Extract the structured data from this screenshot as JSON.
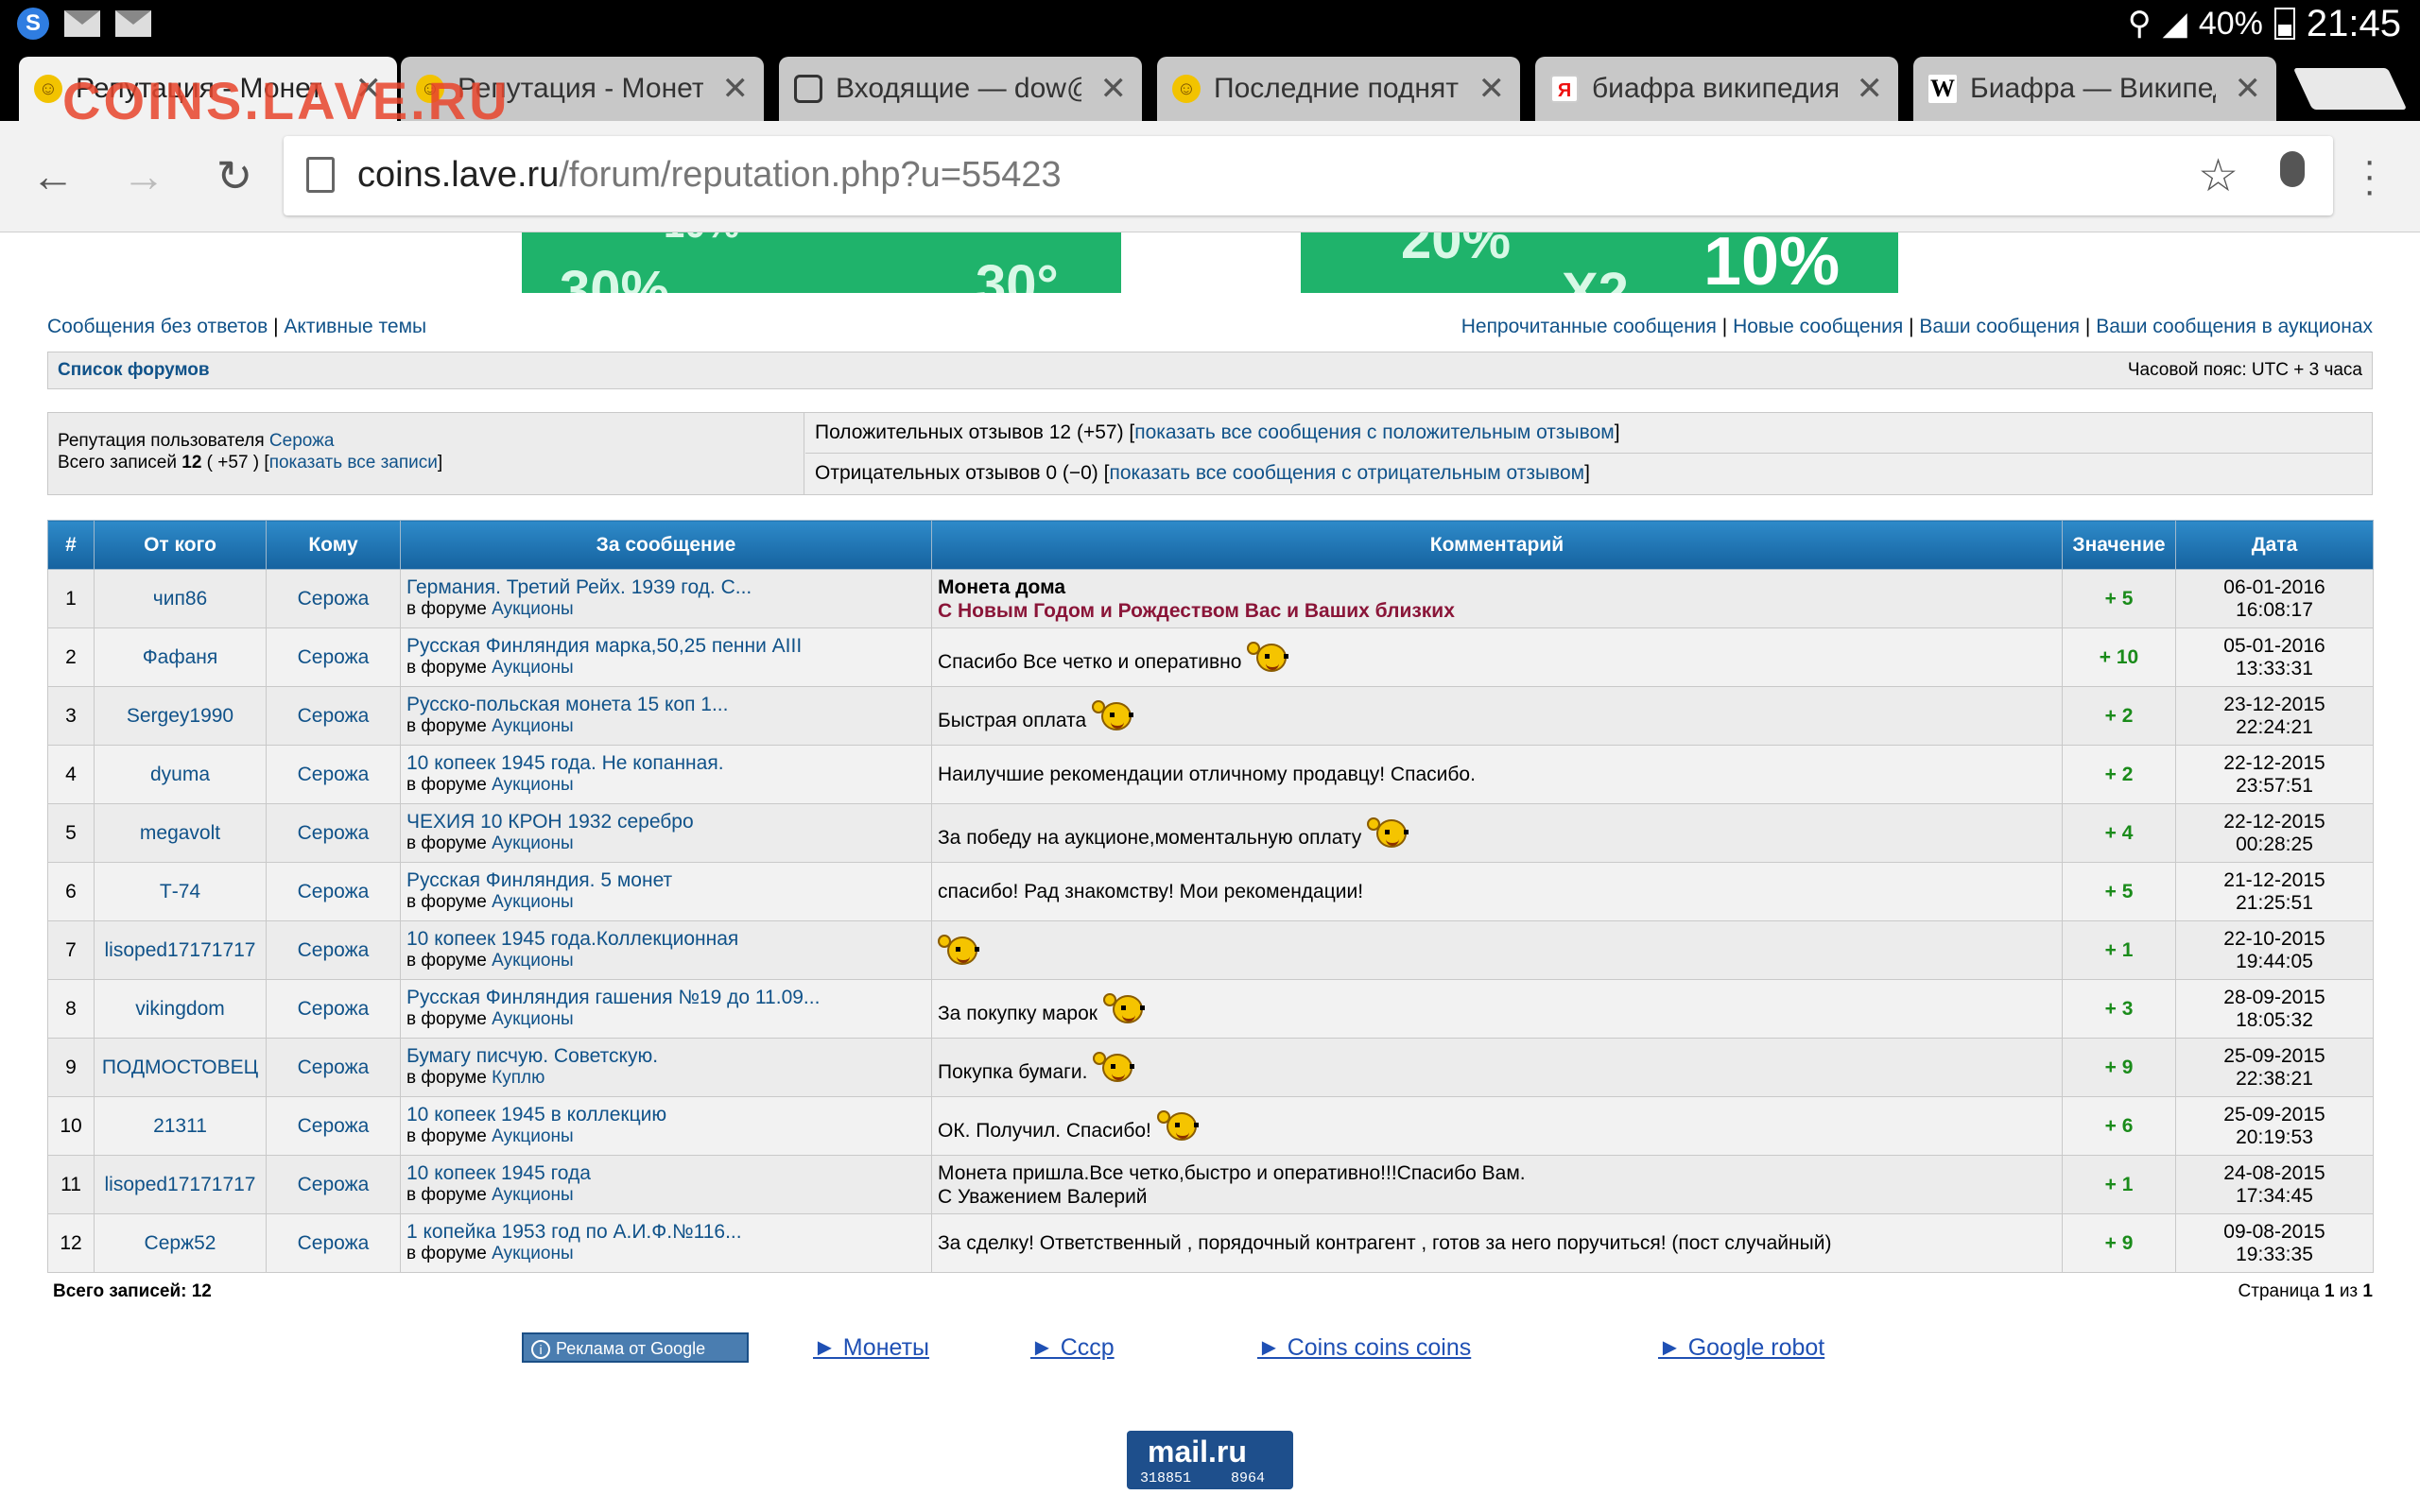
{
  "status_bar": {
    "battery": "40%",
    "time": "21:45"
  },
  "watermark": "COINS.LAVE.RU",
  "tabs": [
    {
      "title": "Репутация - Монеты",
      "icon": "smiley-favicon-icon",
      "active": true
    },
    {
      "title": "Репутация - Монеты",
      "icon": "smiley-favicon-icon",
      "active": false
    },
    {
      "title": "Входящие — dow@ra",
      "icon": "mail-icon",
      "active": false
    },
    {
      "title": "Последние подняты",
      "icon": "smiley-favicon-icon",
      "active": false
    },
    {
      "title": "биафра википедия -",
      "icon": "yandex-icon",
      "active": false
    },
    {
      "title": "Биафра — Википеди",
      "icon": "wikipedia-icon",
      "active": false
    }
  ],
  "toolbar": {
    "url_host": "coins.lave.ru",
    "url_path": "/forum/reputation.php?u=55423"
  },
  "nav": {
    "unanswered": "Сообщения без ответов",
    "sep": "|",
    "active_topics": "Активные темы",
    "unread": "Непрочитанные сообщения",
    "new_posts": "Новые сообщения",
    "your_posts": "Ваши сообщения",
    "your_auction_posts": "Ваши сообщения в аукционах"
  },
  "navbar": {
    "forum_list": "Список форумов",
    "timezone": "Часовой пояс: UTC + 3 часа"
  },
  "reputation": {
    "user_label": "Репутация пользователя",
    "user_name": "Серожа",
    "total_label": "Всего записей",
    "total_count": "12",
    "total_score": "( +57 )",
    "show_all": "показать все записи",
    "positive_text": "Положительных отзывов 12 (+57)",
    "positive_link": "показать все сообщения с положительным отзывом",
    "negative_text": "Отрицательных отзывов 0 (−0)",
    "negative_link": "показать все сообщения с отрицательным отзывом"
  },
  "table": {
    "headers": [
      "#",
      "От кого",
      "Кому",
      "За сообщение",
      "Комментарий",
      "Значение",
      "Дата"
    ],
    "in_forum_label": "в форуме",
    "rows": [
      {
        "n": "1",
        "from": "чип86",
        "to": "Серожа",
        "post": "Германия. Третий Рейх. 1939 год. С...",
        "forum": "Аукционы",
        "comment": "Монета дома",
        "comment2": "С Новым Годом и Рождеством Вас и Ваших близких",
        "smiley": false,
        "value": "+ 5",
        "date": "06-01-2016",
        "time": "16:08:17"
      },
      {
        "n": "2",
        "from": "Фафаня",
        "to": "Серожа",
        "post": "Русская Финляндия марка,50,25 пенни AIII",
        "forum": "Аукционы",
        "comment": "Спасибо Все четко и оперативно",
        "comment2": "",
        "smiley": true,
        "value": "+ 10",
        "date": "05-01-2016",
        "time": "13:33:31"
      },
      {
        "n": "3",
        "from": "Sergey1990",
        "to": "Серожа",
        "post": "Русско-польская монета 15 коп 1...",
        "forum": "Аукционы",
        "comment": "Быстрая оплата",
        "comment2": "",
        "smiley": true,
        "value": "+ 2",
        "date": "23-12-2015",
        "time": "22:24:21"
      },
      {
        "n": "4",
        "from": "dyuma",
        "to": "Серожа",
        "post": "10 копеек 1945 года. Не копанная.",
        "forum": "Аукционы",
        "comment": "Наилучшие рекомендации отличному продавцу! Спасибо.",
        "comment2": "",
        "smiley": false,
        "value": "+ 2",
        "date": "22-12-2015",
        "time": "23:57:51"
      },
      {
        "n": "5",
        "from": "megavolt",
        "to": "Серожа",
        "post": "ЧЕХИЯ 10 КРОН 1932 серебро",
        "forum": "Аукционы",
        "comment": "За победу на аукционе,моментальную оплату",
        "comment2": "",
        "smiley": true,
        "value": "+ 4",
        "date": "22-12-2015",
        "time": "00:28:25"
      },
      {
        "n": "6",
        "from": "Т-74",
        "to": "Серожа",
        "post": "Русская Финляндия. 5 монет",
        "forum": "Аукционы",
        "comment": "спасибо! Рад знакомству! Мои рекомендации!",
        "comment2": "",
        "smiley": false,
        "value": "+ 5",
        "date": "21-12-2015",
        "time": "21:25:51"
      },
      {
        "n": "7",
        "from": "lisoped17171717",
        "to": "Серожа",
        "post": "10 копеек 1945 года.Коллекционная",
        "forum": "Аукционы",
        "comment": "",
        "comment2": "",
        "smiley": true,
        "value": "+ 1",
        "date": "22-10-2015",
        "time": "19:44:05"
      },
      {
        "n": "8",
        "from": "vikingdom",
        "to": "Серожа",
        "post": "Русская Финляндия гашения №19 до 11.09...",
        "forum": "Аукционы",
        "comment": "За покупку марок",
        "comment2": "",
        "smiley": true,
        "value": "+ 3",
        "date": "28-09-2015",
        "time": "18:05:32"
      },
      {
        "n": "9",
        "from": "ПОДМОСТОВЕЦ",
        "to": "Серожа",
        "post": "Бумагу писчую. Советскую.",
        "forum": "Куплю",
        "comment": "Покупка бумаги.",
        "comment2": "",
        "smiley": true,
        "value": "+ 9",
        "date": "25-09-2015",
        "time": "22:38:21"
      },
      {
        "n": "10",
        "from": "21311",
        "to": "Серожа",
        "post": "10 копеек 1945 в коллекцию",
        "forum": "Аукционы",
        "comment": "ОК. Получил. Спасибо!",
        "comment2": "",
        "smiley": true,
        "value": "+ 6",
        "date": "25-09-2015",
        "time": "20:19:53"
      },
      {
        "n": "11",
        "from": "lisoped17171717",
        "to": "Серожа",
        "post": "10 копеек 1945 года",
        "forum": "Аукционы",
        "comment": "Монета пришла.Все четко,быстро и оперативно!!!Спасибо Вам.",
        "comment2": "С Уважением Валерий",
        "smiley": false,
        "value": "+ 1",
        "date": "24-08-2015",
        "time": "17:34:45"
      },
      {
        "n": "12",
        "from": "Серж52",
        "to": "Серожа",
        "post": "1 копейка 1953 год по А.И.Ф.№116...",
        "forum": "Аукционы",
        "comment": "За сделку! Ответственный , порядочный контрагент , готов за него поручиться! (пост случайный)",
        "comment2": "",
        "smiley": false,
        "value": "+ 9",
        "date": "09-08-2015",
        "time": "19:33:35"
      }
    ]
  },
  "footer": {
    "total": "Всего записей: 12",
    "page_label": "Страница",
    "page_current": "1",
    "page_of": "из",
    "page_total": "1"
  },
  "ads": {
    "badge": "Реклама от Google",
    "links": [
      "► Монеты",
      "► Ссср",
      "► Coins coins coins",
      "► Google robot"
    ]
  },
  "mailru": {
    "logo": "mail.ru",
    "counter1": "318851",
    "counter2": "8964"
  },
  "colors": {
    "link": "#105289",
    "header_blue": "#1f74b3",
    "value_green": "#1a8b1a",
    "banner_green": "#1fb36b"
  }
}
